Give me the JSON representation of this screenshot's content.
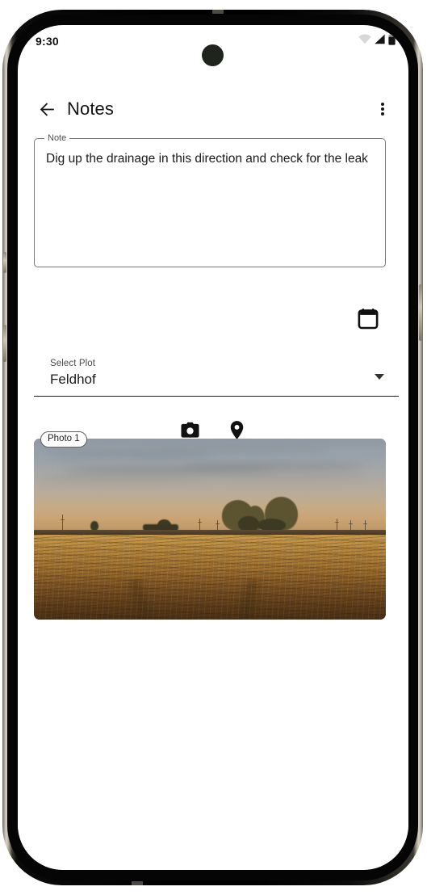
{
  "status_bar": {
    "time": "9:30",
    "icons": [
      {
        "name": "wifi-icon",
        "label": "Wi-Fi"
      },
      {
        "name": "cellular-signal-icon",
        "label": "Signal"
      },
      {
        "name": "battery-icon",
        "label": "Battery"
      }
    ]
  },
  "app_bar": {
    "back_icon": "arrow-back-icon",
    "title": "Notes",
    "overflow_icon": "more-vert-icon"
  },
  "note_field": {
    "label": "Note",
    "value": "Dig up the drainage in this direction and check for the leak",
    "placeholder": "Note"
  },
  "date_row": {
    "calendar_icon": "calendar-icon",
    "calendar_label": "Select date"
  },
  "select_plot": {
    "label": "Select Plot",
    "value": "Feldhof",
    "caret_icon": "chevron-down-icon",
    "options": [
      "Feldhof"
    ]
  },
  "media_actions": [
    {
      "name": "camera-button",
      "icon": "camera-icon",
      "label": "Add photo"
    },
    {
      "name": "location-button",
      "icon": "map-pin-icon",
      "label": "Add location"
    }
  ],
  "photo": {
    "chip_label": "Photo 1",
    "description": "Harvested farm field at sunset with tractor tracks and trees on the horizon"
  },
  "colors": {
    "accent": "#1c1c1c",
    "text_primary": "#1a1a1a",
    "text_secondary": "#4e4e4e",
    "field_border": "#767676",
    "screen_bg": "#ffffff",
    "frame_metal": "#b9b2a5",
    "frame_bezel": "#000000",
    "punch_hole": "#1f241c"
  }
}
